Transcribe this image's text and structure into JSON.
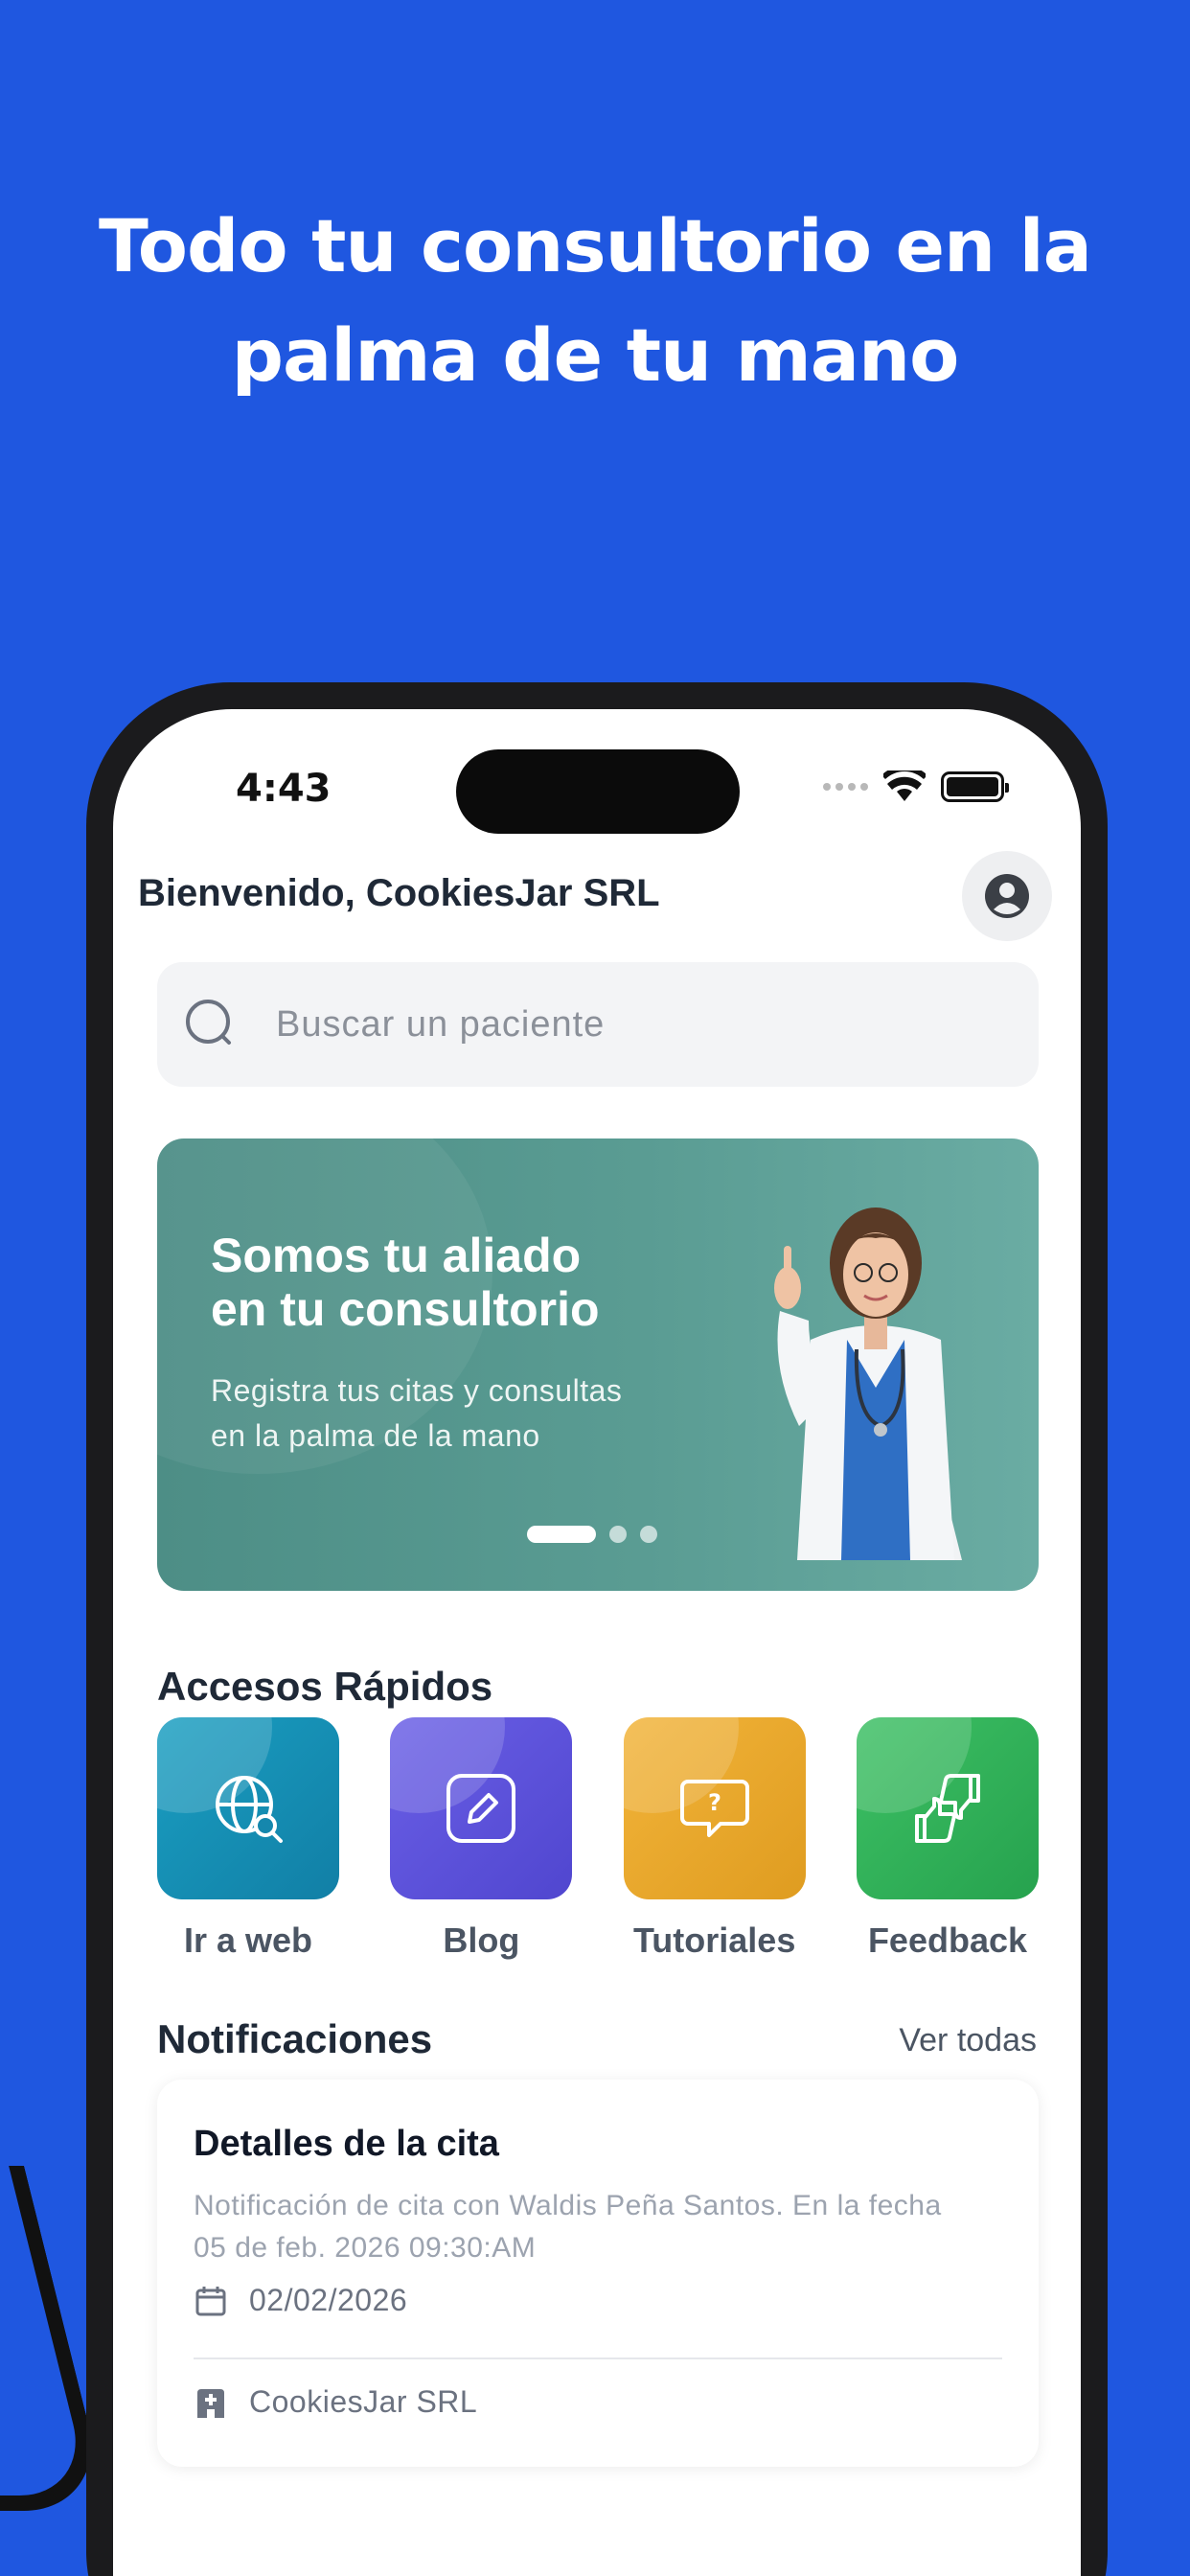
{
  "headline": [
    "Todo tu consultorio en la",
    "palma de tu mano"
  ],
  "status_bar": {
    "time": "4:43"
  },
  "header": {
    "welcome": "Bienvenido, CookiesJar SRL"
  },
  "search": {
    "placeholder": "Buscar un paciente"
  },
  "banner": {
    "title": [
      "Somos tu aliado",
      "en tu consultorio"
    ],
    "subtitle": [
      "Registra tus citas y consultas",
      "en la palma de la mano"
    ],
    "active_slide": 1,
    "slide_count": 3
  },
  "quick_access": {
    "title": "Accesos Rápidos",
    "items": [
      {
        "label": "Ir a web",
        "icon": "globe-search-icon",
        "color": "#1490b4"
      },
      {
        "label": "Blog",
        "icon": "edit-pencil-icon",
        "color": "#5a50d8"
      },
      {
        "label": "Tutoriales",
        "icon": "question-bubble-icon",
        "color": "#e8a92a"
      },
      {
        "label": "Feedback",
        "icon": "thumbs-up-down-icon",
        "color": "#2fb35a"
      }
    ]
  },
  "notifications": {
    "title": "Notificaciones",
    "see_all": "Ver todas",
    "items": [
      {
        "title": "Detalles de la cita",
        "description": [
          "Notificación de cita con Waldis Peña Santos. En la fecha",
          "05 de feb. 2026 09:30:AM"
        ],
        "date": "02/02/2026",
        "clinic": "CookiesJar SRL"
      }
    ]
  },
  "colors": {
    "background": "#1f57e0",
    "banner": "#5a9c93",
    "text_dark": "#1f2937"
  }
}
